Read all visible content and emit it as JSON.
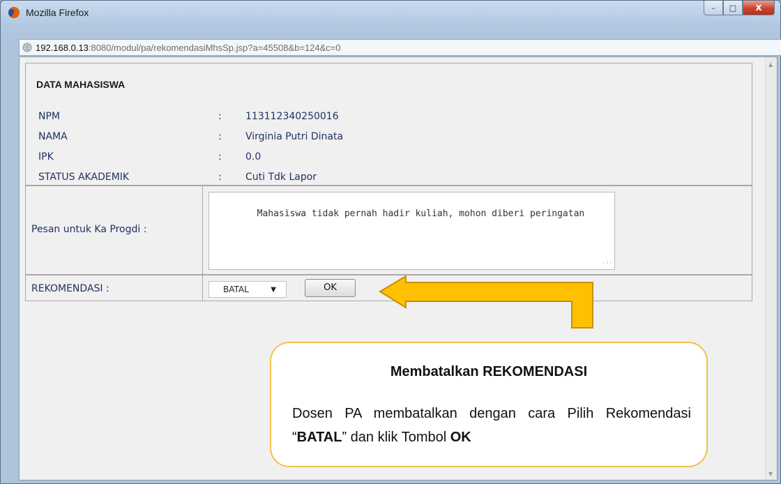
{
  "window": {
    "title": "Mozilla Firefox",
    "controls": {
      "minimize": "–",
      "maximize": "□",
      "close": "x"
    }
  },
  "urlbar": {
    "host": "192.168.0.13",
    "rest": ":8080/modul/pa/rekomendasiMhsSp.jsp?a=45508&b=124&c=0"
  },
  "section": {
    "title": "DATA MAHASISWA"
  },
  "fields": [
    {
      "label": "NPM",
      "colon": ":",
      "value": "113112340250016"
    },
    {
      "label": "NAMA",
      "colon": ":",
      "value": "Virginia Putri Dinata"
    },
    {
      "label": "IPK",
      "colon": ":",
      "value": "0.0"
    },
    {
      "label": "STATUS AKADEMIK",
      "colon": ":",
      "value": "Cuti Tdk Lapor"
    }
  ],
  "pesan": {
    "label": "Pesan untuk Ka Progdi :",
    "value": "Mahasiswa tidak pernah hadir kuliah, mohon diberi peringatan"
  },
  "rekomendasi": {
    "label": "REKOMENDASI :",
    "selected": "BATAL",
    "ok_label": "OK"
  },
  "callout": {
    "title": "Membatalkan REKOMENDASI",
    "body_1": "Dosen PA membatalkan dengan cara Pilih Rekomendasi “",
    "body_bold_1": "BATAL",
    "body_2": "” dan klik Tombol ",
    "body_bold_2": "OK"
  },
  "colors": {
    "arrow_fill": "#ffc000",
    "arrow_stroke": "#c98d00",
    "callout_border": "#f0c24a",
    "label_text": "#1f2f5f"
  }
}
